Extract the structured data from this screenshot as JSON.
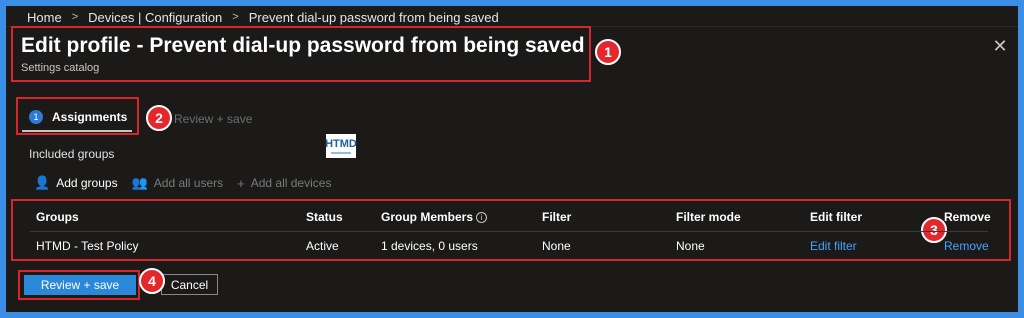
{
  "breadcrumb": [
    "Home",
    "Devices | Configuration",
    "Prevent dial-up password from being saved"
  ],
  "breadcrumb_separator": ">",
  "header": {
    "title": "Edit profile - Prevent dial-up password from being saved",
    "subtitle": "Settings catalog",
    "close_icon": "close-icon"
  },
  "wizard": {
    "steps": [
      {
        "number": "1",
        "label": "Assignments"
      },
      {
        "label": "Review + save"
      }
    ]
  },
  "logo_text": "HTMD",
  "assignments": {
    "section_label": "Included groups",
    "commands": [
      {
        "label": "Add groups",
        "icon": "user-icon",
        "glyph": "👤"
      },
      {
        "label": "Add all users",
        "icon": "users-icon",
        "glyph": "👥"
      },
      {
        "label": "Add all devices",
        "icon": "plus-icon",
        "glyph": "+"
      }
    ]
  },
  "table": {
    "columns": [
      "Groups",
      "Status",
      "Group Members",
      "Filter",
      "Filter mode",
      "Edit filter",
      "Remove"
    ],
    "rows": [
      {
        "group": "HTMD - Test Policy",
        "status": "Active",
        "members": "1 devices, 0 users",
        "filter": "None",
        "filter_mode": "None",
        "edit_filter": "Edit filter",
        "remove": "Remove"
      }
    ]
  },
  "footer": {
    "primary": "Review + save",
    "secondary": "Cancel"
  },
  "callouts": [
    "1",
    "2",
    "3",
    "4"
  ],
  "colors": {
    "accent": "#2b88d8",
    "link": "#4aa0ff",
    "callout": "#d9262c",
    "background": "#1b1a19"
  }
}
